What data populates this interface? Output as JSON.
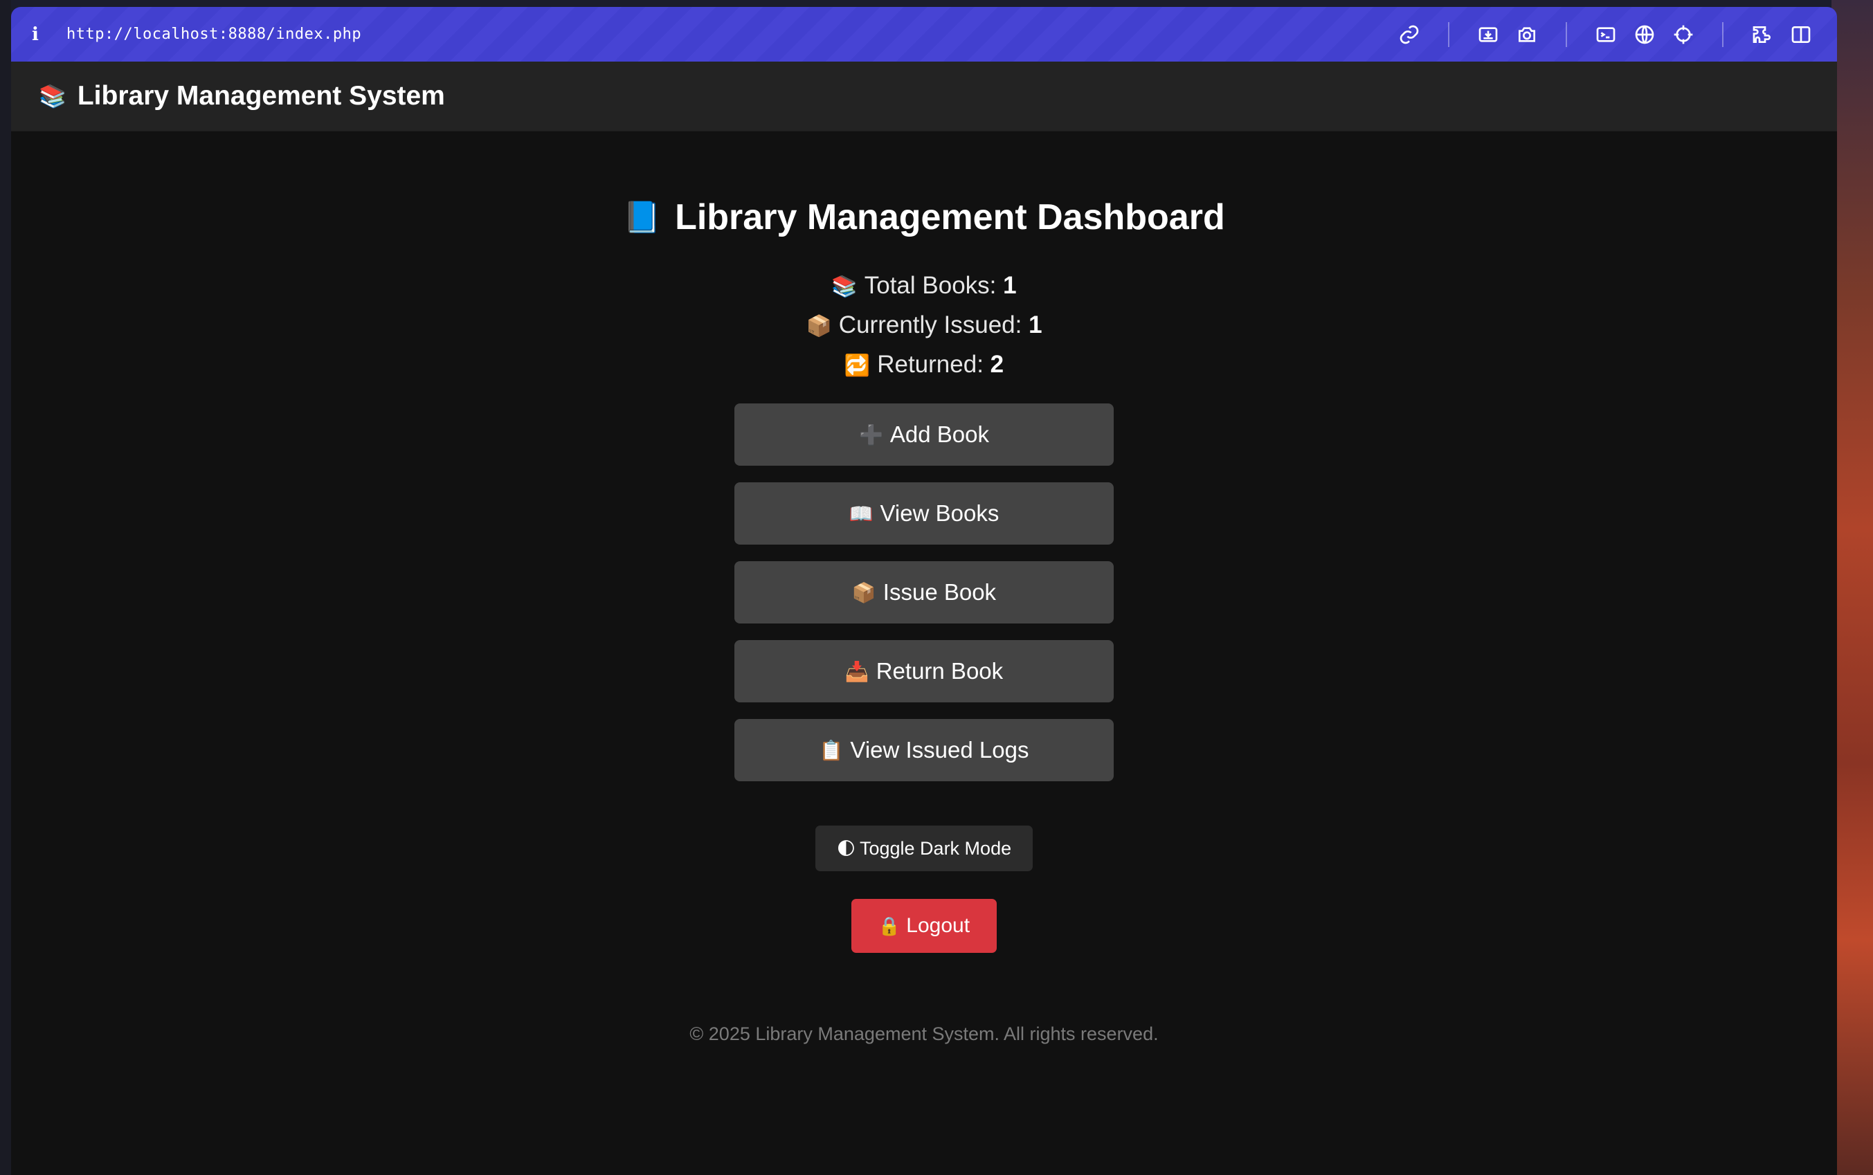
{
  "browser": {
    "url": "http://localhost:8888/index.php",
    "info_icon": "i",
    "toolbar_icons": [
      "link-icon",
      "download-icon",
      "camera-icon",
      "terminal-icon",
      "globe-icon",
      "crosshair-icon",
      "extension-icon",
      "sidebar-icon"
    ]
  },
  "navbar": {
    "brand_emoji": "📚",
    "brand": "Library Management System"
  },
  "dashboard": {
    "title_emoji": "📘",
    "title": "Library Management Dashboard",
    "stats": [
      {
        "emoji": "📚",
        "label": "Total Books: ",
        "value": "1"
      },
      {
        "emoji": "📦",
        "label": "Currently Issued: ",
        "value": "1"
      },
      {
        "emoji": "🔁",
        "label": "Returned: ",
        "value": "2"
      }
    ],
    "buttons": [
      {
        "emoji": "➕",
        "label": "Add Book"
      },
      {
        "emoji": "📖",
        "label": "View Books"
      },
      {
        "emoji": "📦",
        "label": "Issue Book"
      },
      {
        "emoji": "📥",
        "label": "Return Book"
      },
      {
        "emoji": "📋",
        "label": "View Issued Logs"
      }
    ],
    "toggle": {
      "emoji": "🌓",
      "label": "Toggle Dark Mode"
    },
    "logout": {
      "emoji": "🔒",
      "label": "Logout"
    },
    "footer": "© 2025 Library Management System. All rights reserved."
  },
  "colors": {
    "url_bar": "#4240cf",
    "navbar": "#232323",
    "background": "#111111",
    "button": "#444444",
    "logout": "#d9363e"
  }
}
